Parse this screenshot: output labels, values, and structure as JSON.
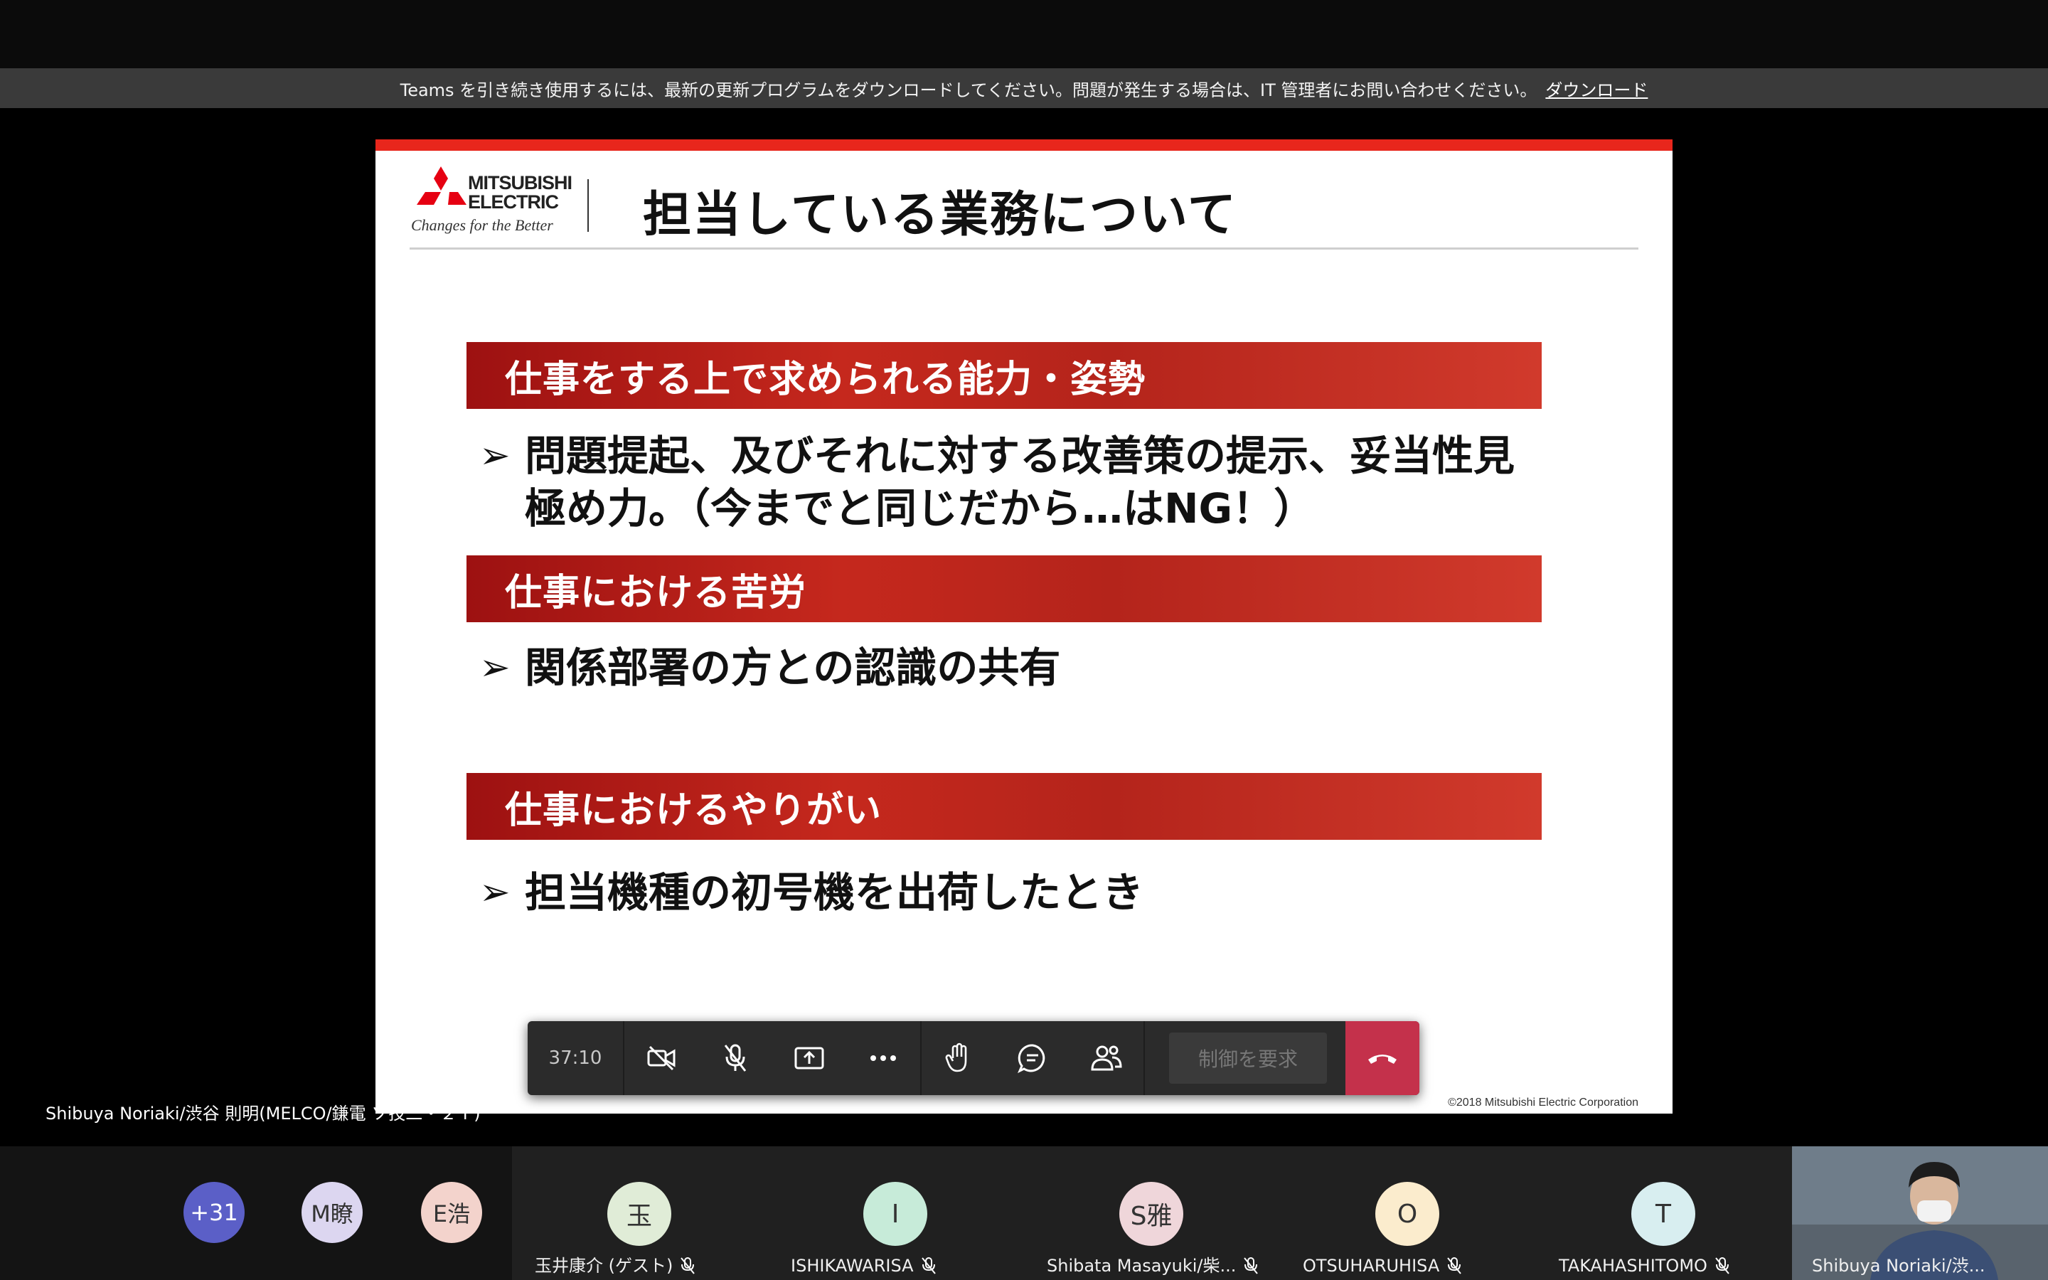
{
  "banner": {
    "message": "Teams を引き続き使用するには、最新の更新プログラムをダウンロードしてください。問題が発生する場合は、IT 管理者にお問い合わせください。",
    "link": "ダウンロード"
  },
  "slide": {
    "logo_name": "MITSUBISHI\nELECTRIC",
    "logo_tagline": "Changes for the Better",
    "title": "担当している業務について",
    "sections": [
      {
        "heading": "仕事をする上で求められる能力・姿勢",
        "bullet": "問題提起、及びそれに対する改善策の提示、妥当性見極め力。（今までと同じだから…はNG！）"
      },
      {
        "heading": "仕事における苦労",
        "bullet": "関係部署の方との認識の共有"
      },
      {
        "heading": "仕事におけるやりがい",
        "bullet": "担当機種の初号機を出荷したとき"
      }
    ],
    "bullet_marker": "➢",
    "copyright": "©2018 Mitsubishi Electric Corporation"
  },
  "controls": {
    "timer": "37:10",
    "request_control": "制御を要求",
    "icons": [
      "camera-off-icon",
      "mic-off-icon",
      "share-tray-icon",
      "more-icon",
      "raise-hand-icon",
      "chat-icon",
      "participants-icon",
      "hang-up-icon"
    ]
  },
  "presenter_label": "Shibuya Noriaki/渋谷 則明(MELCO/鎌電 ソ技二・２Ｔ)",
  "participants": {
    "small": [
      {
        "initials": "+31",
        "bg": "#5b5fc7",
        "fg": "#ffffff"
      },
      {
        "initials": "M瞭",
        "bg": "#dcd6f0",
        "fg": "#333333"
      },
      {
        "initials": "E浩",
        "bg": "#f3d3cc",
        "fg": "#333333"
      }
    ],
    "tiles": [
      {
        "initials": "玉",
        "name": "玉井康介 (ゲスト)",
        "bg": "#e0ecd7"
      },
      {
        "initials": "I",
        "name": "ISHIKAWARISA",
        "bg": "#c7ebd9"
      },
      {
        "initials": "S雅",
        "name": "Shibata Masayuki/柴...",
        "bg": "#efd6da"
      },
      {
        "initials": "O",
        "name": "OTSUHARUHISA",
        "bg": "#fbeccd"
      },
      {
        "initials": "T",
        "name": "TAKAHASHITOMO",
        "bg": "#d8eef0"
      }
    ],
    "video_name": "Shibuya Noriaki/渋..."
  }
}
